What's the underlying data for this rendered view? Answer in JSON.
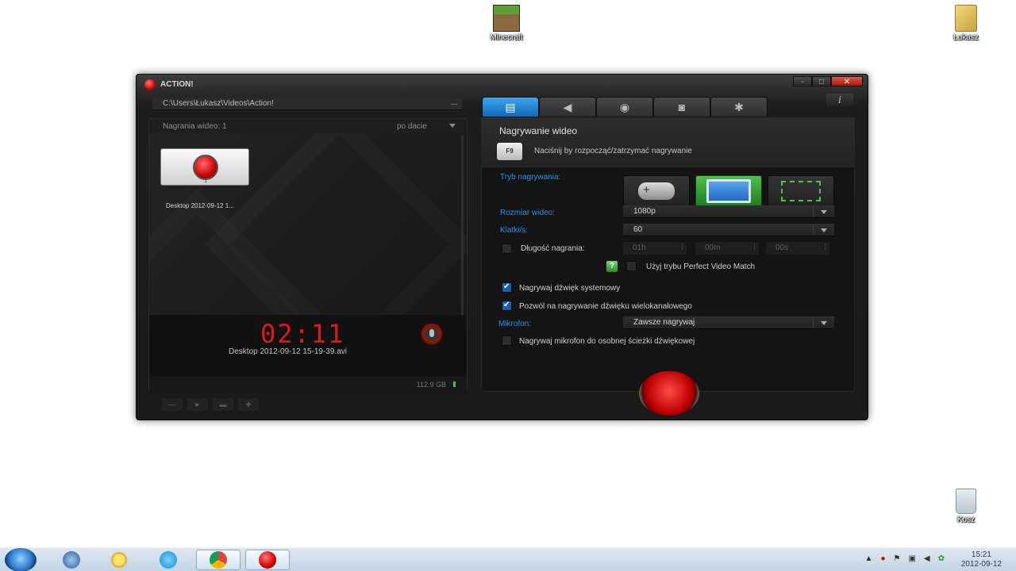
{
  "desktop": {
    "icons": [
      {
        "label": "Minecraft"
      },
      {
        "label": "Łukasz"
      },
      {
        "label": "Kosz"
      }
    ]
  },
  "window": {
    "title": "ACTION!",
    "controls": {
      "minimize": "-",
      "maximize": "□",
      "close": "✕"
    }
  },
  "left": {
    "path": "C:\\Users\\Łukasz\\Videos\\Action!",
    "path_button": "...",
    "list_count": "Nagrania wideo: 1",
    "sort_label": "po dacie",
    "item": {
      "label": "Desktop 2012-09-12 1...",
      "number": "1"
    },
    "timer": "02:11",
    "current_file": "Desktop 2012-09-12 15-19-39.avi",
    "disk_free": "112.9 GB"
  },
  "right": {
    "tabs": [
      {
        "name": "video",
        "icon": "film-icon"
      },
      {
        "name": "audio",
        "icon": "speaker-icon"
      },
      {
        "name": "benchmark",
        "icon": "stopwatch-icon"
      },
      {
        "name": "screenshot",
        "icon": "camera-icon"
      },
      {
        "name": "settings",
        "icon": "gear-icon"
      }
    ],
    "info_label": "i",
    "section_title": "Nagrywanie wideo",
    "hotkey": "F9",
    "hotkey_hint": "Naciśnij by rozpocząć/zatrzymać nagrywanie",
    "mode_label": "Tryb nagrywania:",
    "size_label": "Rozmiar wideo:",
    "size_value": "1080p",
    "fps_label": "Klatki/s:",
    "fps_value": "60",
    "length_label": "Długość nagrania:",
    "length_h": "01h",
    "length_m": "00m",
    "length_s": "00s",
    "perfect_match_label": "Użyj trybu Perfect Video Match",
    "help_label": "?",
    "system_sound_label": "Nagrywaj dźwięk systemowy",
    "multichannel_label": "Pozwól na nagrywanie dźwięku wielokanałowego",
    "mic_label": "Mikrofon:",
    "mic_value": "Zawsze nagrywaj",
    "mic_separate_label": "Nagrywaj mikrofon do osobnej ścieżki dźwiękowej"
  },
  "taskbar": {
    "time": "15:21",
    "date": "2012-09-12"
  },
  "colors": {
    "accent_blue": "#1268b8",
    "record_red": "#c10000",
    "mode_active_green": "#1f7d1f",
    "timer_red": "#e01818"
  }
}
